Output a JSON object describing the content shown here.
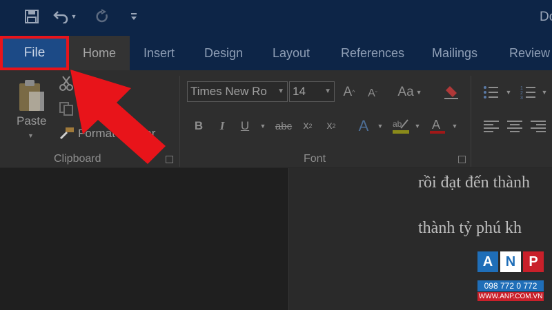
{
  "titlebar": {
    "doc_title": "Do"
  },
  "tabs": [
    {
      "label": "File"
    },
    {
      "label": "Home"
    },
    {
      "label": "Insert"
    },
    {
      "label": "Design"
    },
    {
      "label": "Layout"
    },
    {
      "label": "References"
    },
    {
      "label": "Mailings"
    },
    {
      "label": "Review"
    }
  ],
  "clipboard": {
    "paste_label": "Paste",
    "format_painter_label": "Format Painter",
    "group_label": "Clipboard"
  },
  "font": {
    "font_name": "Times New Ro",
    "font_size": "14",
    "group_label": "Font",
    "change_case_label": "Aa"
  },
  "document": {
    "lines": [
      "rồi đạt đến thành",
      "thành tỷ phú kh"
    ]
  },
  "logo": {
    "letters": [
      "A",
      "N",
      "P"
    ],
    "phone": "098 772 0 772",
    "url": "WWW.ANP.COM.VN"
  },
  "colors": {
    "highlight_border": "#e8141a",
    "arrow": "#e8141a",
    "ribbon_bg": "#2e2e2e",
    "titlebar_bg": "#0d2547"
  }
}
